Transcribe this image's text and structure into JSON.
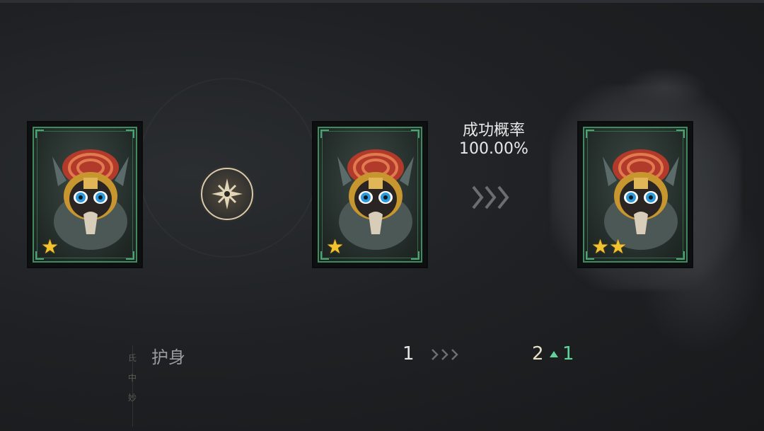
{
  "success": {
    "label": "成功概率",
    "value": "100.00%"
  },
  "cards": [
    {
      "name": "source-card-1",
      "stars": "★"
    },
    {
      "name": "source-card-2",
      "stars": "★"
    },
    {
      "name": "result-card",
      "stars": "★★"
    }
  ],
  "stat": {
    "name": "护身",
    "from": "1",
    "to": "2",
    "delta": "1"
  },
  "side_text": "氏 中 妙",
  "colors": {
    "frame": "#3f8a5e",
    "star": "#f2c230",
    "increase": "#5fd39a"
  },
  "icons": [
    "rune-compass-icon",
    "chevrons-right-icon",
    "up-arrow-icon",
    "star-icon"
  ]
}
